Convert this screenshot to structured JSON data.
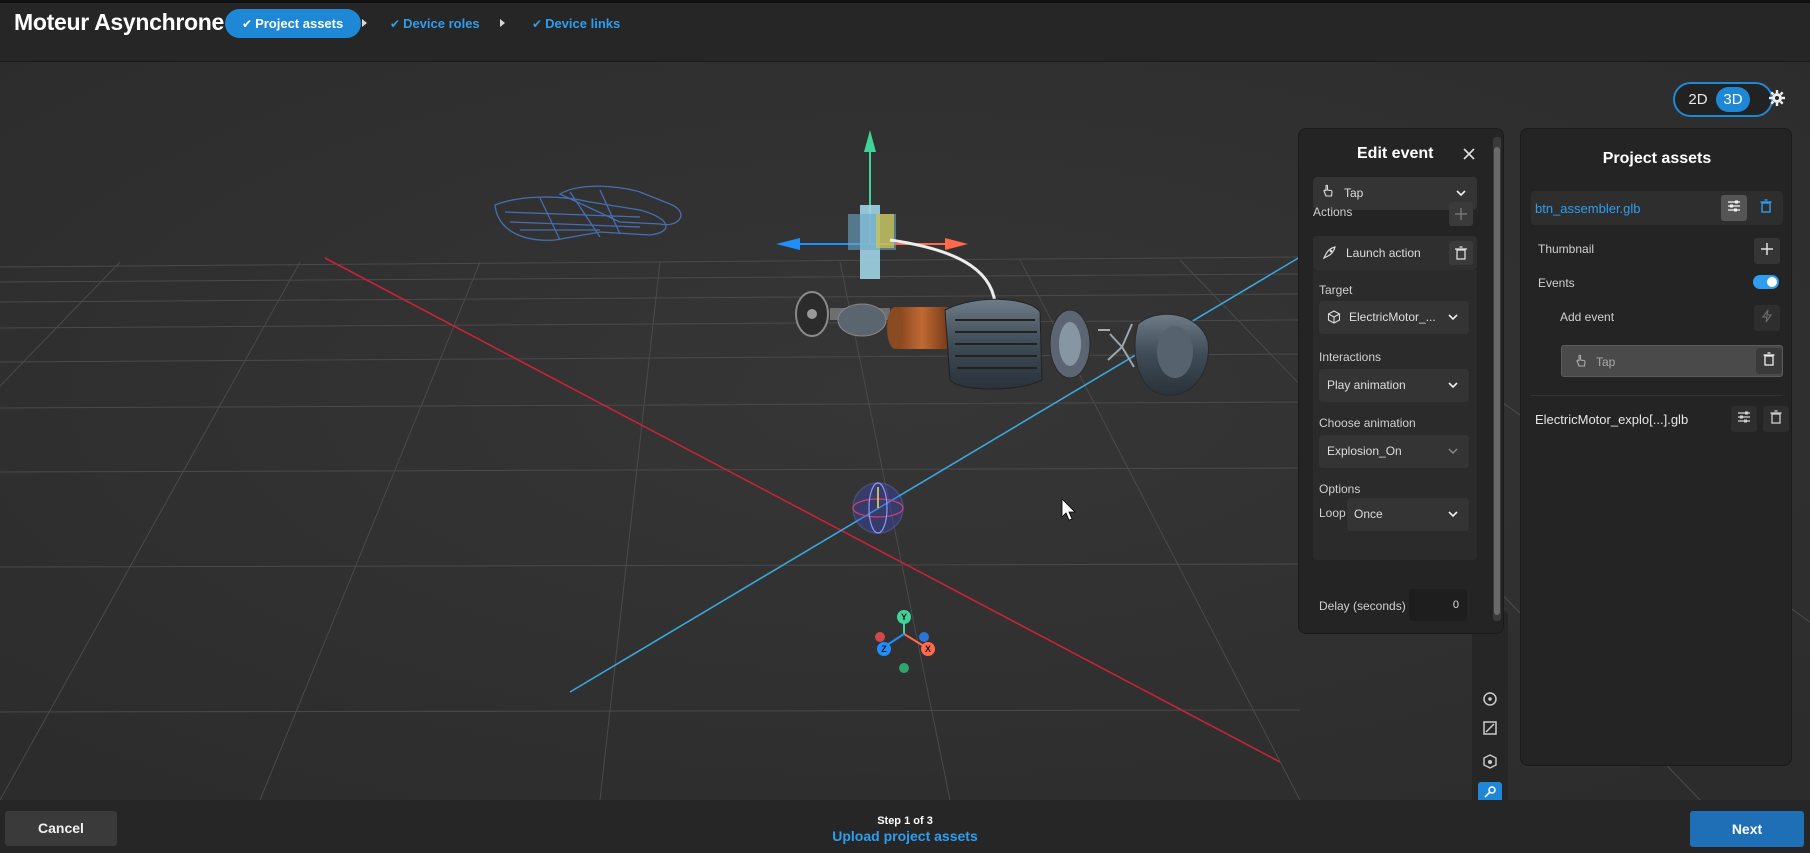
{
  "app": {
    "title": "Moteur Asynchrone"
  },
  "steps": [
    {
      "label": "Project assets",
      "state": "active"
    },
    {
      "label": "Device roles",
      "state": "done"
    },
    {
      "label": "Device links",
      "state": "done"
    }
  ],
  "view_toggle": {
    "mode_2d": "2D",
    "mode_3d": "3D",
    "selected": "3D"
  },
  "edit_event": {
    "title": "Edit event",
    "event_type": "Tap",
    "actions_label": "Actions",
    "action_name": "Launch action",
    "target_label": "Target",
    "target_value": "ElectricMotor_...",
    "interactions_label": "Interactions",
    "interaction_value": "Play animation",
    "choose_animation_label": "Choose animation",
    "animation_value": "Explosion_On",
    "options_label": "Options",
    "loop_label": "Loop",
    "loop_value": "Once",
    "delay_label": "Delay (seconds)",
    "delay_value": "0"
  },
  "project_assets": {
    "title": "Project assets",
    "asset_1": "btn_assembler.glb",
    "thumbnail_label": "Thumbnail",
    "events_label": "Events",
    "events_enabled": true,
    "add_event_label": "Add event",
    "event_item": "Tap",
    "asset_2": "ElectricMotor_explo[...].glb"
  },
  "footer": {
    "cancel": "Cancel",
    "step_counter": "Step 1 of 3",
    "step_name": "Upload project assets",
    "next": "Next"
  },
  "colors": {
    "accent": "#1f88d6",
    "link": "#2e9df0",
    "axis_red": "#c8223a",
    "axis_blue": "#3aa6dc",
    "gizmo_green": "#3fd39a",
    "gizmo_red": "#ff6a4d",
    "gizmo_blue": "#1f8fff"
  }
}
